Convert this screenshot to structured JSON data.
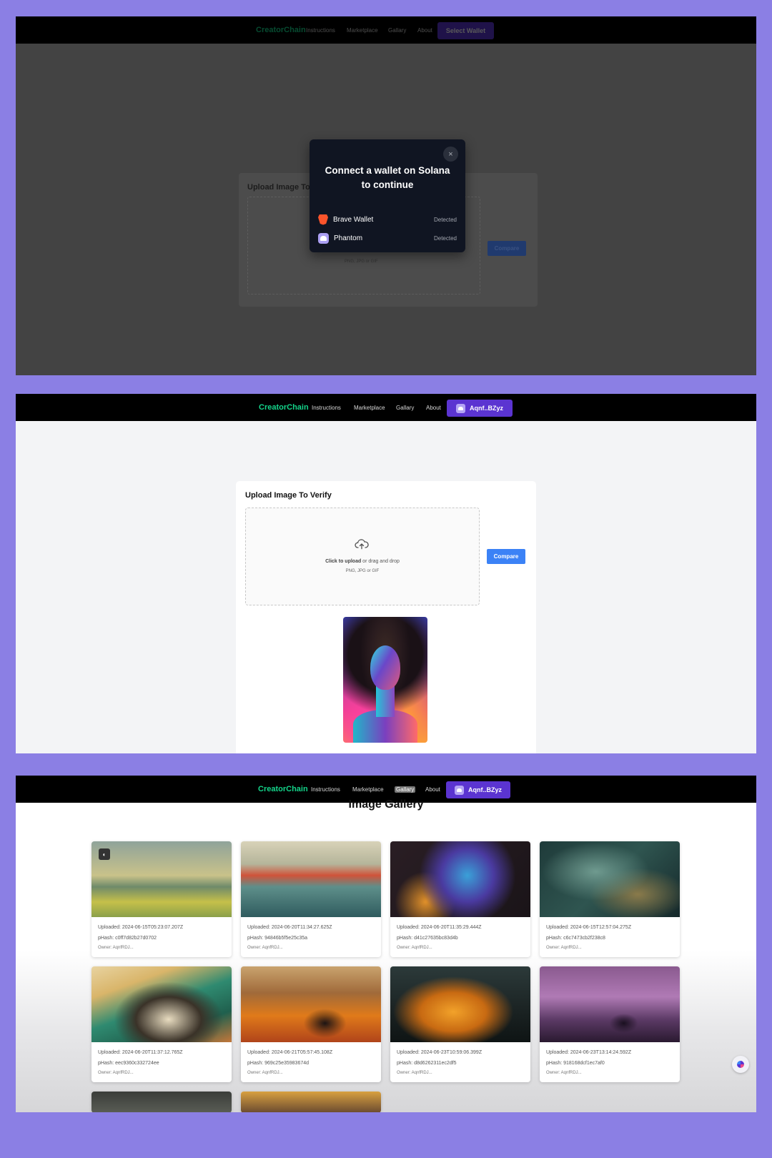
{
  "screens": {
    "connect": {
      "nav": {
        "brand": "CreatorChain",
        "links": [
          "Instructions",
          "Marketplace",
          "Gallary",
          "About"
        ],
        "wallet_button": "Select Wallet"
      },
      "background": {
        "card_title": "Upload Image To",
        "formats": "PNG, JPG or GIF",
        "compare_label": "Compare"
      },
      "modal": {
        "title": "Connect a wallet on Solana to continue",
        "close_icon": "×",
        "wallets": [
          {
            "name": "Brave Wallet",
            "status": "Detected",
            "icon": "brave-icon"
          },
          {
            "name": "Phantom",
            "status": "Detected",
            "icon": "phantom-icon"
          }
        ]
      }
    },
    "verify": {
      "nav": {
        "brand": "CreatorChain",
        "links": [
          "Instructions",
          "Marketplace",
          "Gallary",
          "About"
        ],
        "wallet_button": "Aqnf..BZyz"
      },
      "card": {
        "title": "Upload Image To Verify",
        "hint_bold": "Click to upload",
        "hint_rest": " or drag and drop",
        "formats": "PNG, JPG or GIF",
        "compare_label": "Compare",
        "upload_icon": "cloud-upload-icon"
      }
    },
    "gallery": {
      "nav": {
        "brand": "CreatorChain",
        "links": [
          "Instructions",
          "Marketplace",
          "Gallary",
          "About"
        ],
        "active_link": "Gallary",
        "wallet_button": "Aqnf..BZyz"
      },
      "title": "Image Gallery",
      "items": [
        {
          "uploaded": "Uploaded: 2024-06-15T05:23:07.207Z",
          "phash": "pHash: c0ff7d82b27d0702",
          "owner": "Owner: AqnfRDJ..."
        },
        {
          "uploaded": "Uploaded: 2024-06-20T11:34:27.625Z",
          "phash": "pHash: 94846b5f5e25c35a",
          "owner": "Owner: AqnfRDJ..."
        },
        {
          "uploaded": "Uploaded: 2024-06-20T11:35:29.444Z",
          "phash": "pHash: d41c27635bc83d4b",
          "owner": "Owner: AqnfRDJ..."
        },
        {
          "uploaded": "Uploaded: 2024-06-15T12:57:04.275Z",
          "phash": "pHash: c6c7473cb2f238c8",
          "owner": "Owner: AqnfRDJ..."
        },
        {
          "uploaded": "Uploaded: 2024-06-20T11:37:12.765Z",
          "phash": "pHash: eec9360c332724ee",
          "owner": "Owner: AqnfRDJ..."
        },
        {
          "uploaded": "Uploaded: 2024-06-21T05:57:45.108Z",
          "phash": "pHash: 969c25e35983674d",
          "owner": "Owner: AqnfRDJ..."
        },
        {
          "uploaded": "Uploaded: 2024-06-23T10:59:06.399Z",
          "phash": "pHash: d8d6262311ec2df5",
          "owner": "Owner: AqnfRDJ..."
        },
        {
          "uploaded": "Uploaded: 2024-06-23T13:14:24.592Z",
          "phash": "pHash: 918168dcf1ec7af0",
          "owner": "Owner: AqnfRDJ..."
        }
      ]
    }
  },
  "colors": {
    "background": "#8b7fe4",
    "brand_green": "#14d48a",
    "wallet_purple": "#5b34d1",
    "compare_blue": "#3b82f6",
    "modal_bg": "#101522"
  }
}
